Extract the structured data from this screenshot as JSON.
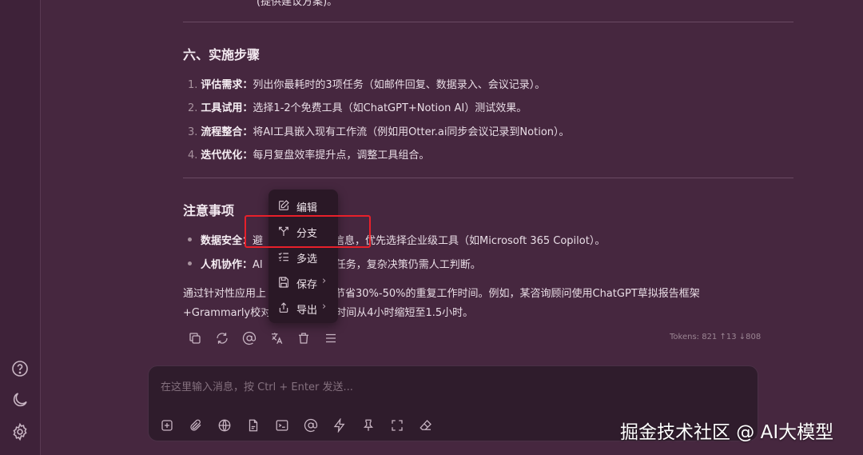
{
  "top_text": "(提供建议方案)。",
  "section6": {
    "title": "六、实施步骤",
    "items": [
      {
        "num": "1.",
        "bold": "评估需求：",
        "text": "列出你最耗时的3项任务（如邮件回复、数据录入、会议记录）。"
      },
      {
        "num": "2.",
        "bold": "工具试用：",
        "text": "选择1-2个免费工具（如ChatGPT+Notion AI）测试效果。"
      },
      {
        "num": "3.",
        "bold": "流程整合：",
        "text": "将AI工具嵌入现有工作流（例如用Otter.ai同步会议记录到Notion）。"
      },
      {
        "num": "4.",
        "bold": "迭代优化：",
        "text": "每月复盘效率提升点，调整工具组合。"
      }
    ]
  },
  "notes": {
    "title": "注意事项",
    "items": [
      {
        "bold": "数据安全：",
        "text_pre": "避",
        "text_post": "感信息，优先选择企业级工具（如Microsoft 365 Copilot）。"
      },
      {
        "bold": "人机协作：",
        "text_pre": "AI",
        "text_post": "化任务，复杂决策仍需人工判断。"
      }
    ]
  },
  "summary": {
    "line1_pre": "通过针对性应用上",
    "line1_post": "可节省30%-50%的重复工作时间。例如，某咨询顾问使用ChatGPT草拟报告框架",
    "line2_pre": "+Grammarly校对",
    "line2_post": "时间从4小时缩短至1.5小时。"
  },
  "tokens": "Tokens: 821 ↑13 ↓808",
  "context_menu": {
    "items": [
      {
        "label": "编辑",
        "icon": "edit-icon",
        "submenu": false
      },
      {
        "label": "分支",
        "icon": "branch-icon",
        "submenu": false
      },
      {
        "label": "多选",
        "icon": "multiselect-icon",
        "submenu": false
      },
      {
        "label": "保存",
        "icon": "save-icon",
        "submenu": true
      },
      {
        "label": "导出",
        "icon": "export-icon",
        "submenu": true
      }
    ],
    "chevron": "›"
  },
  "input": {
    "placeholder": "在这里输入消息，按 Ctrl + Enter 发送..."
  },
  "watermark": "掘金技术社区 @ AI大模型",
  "colors": {
    "background": "#46273f",
    "sidebar": "#3e2239",
    "menu": "#2a1826",
    "highlight": "#e8202a"
  }
}
